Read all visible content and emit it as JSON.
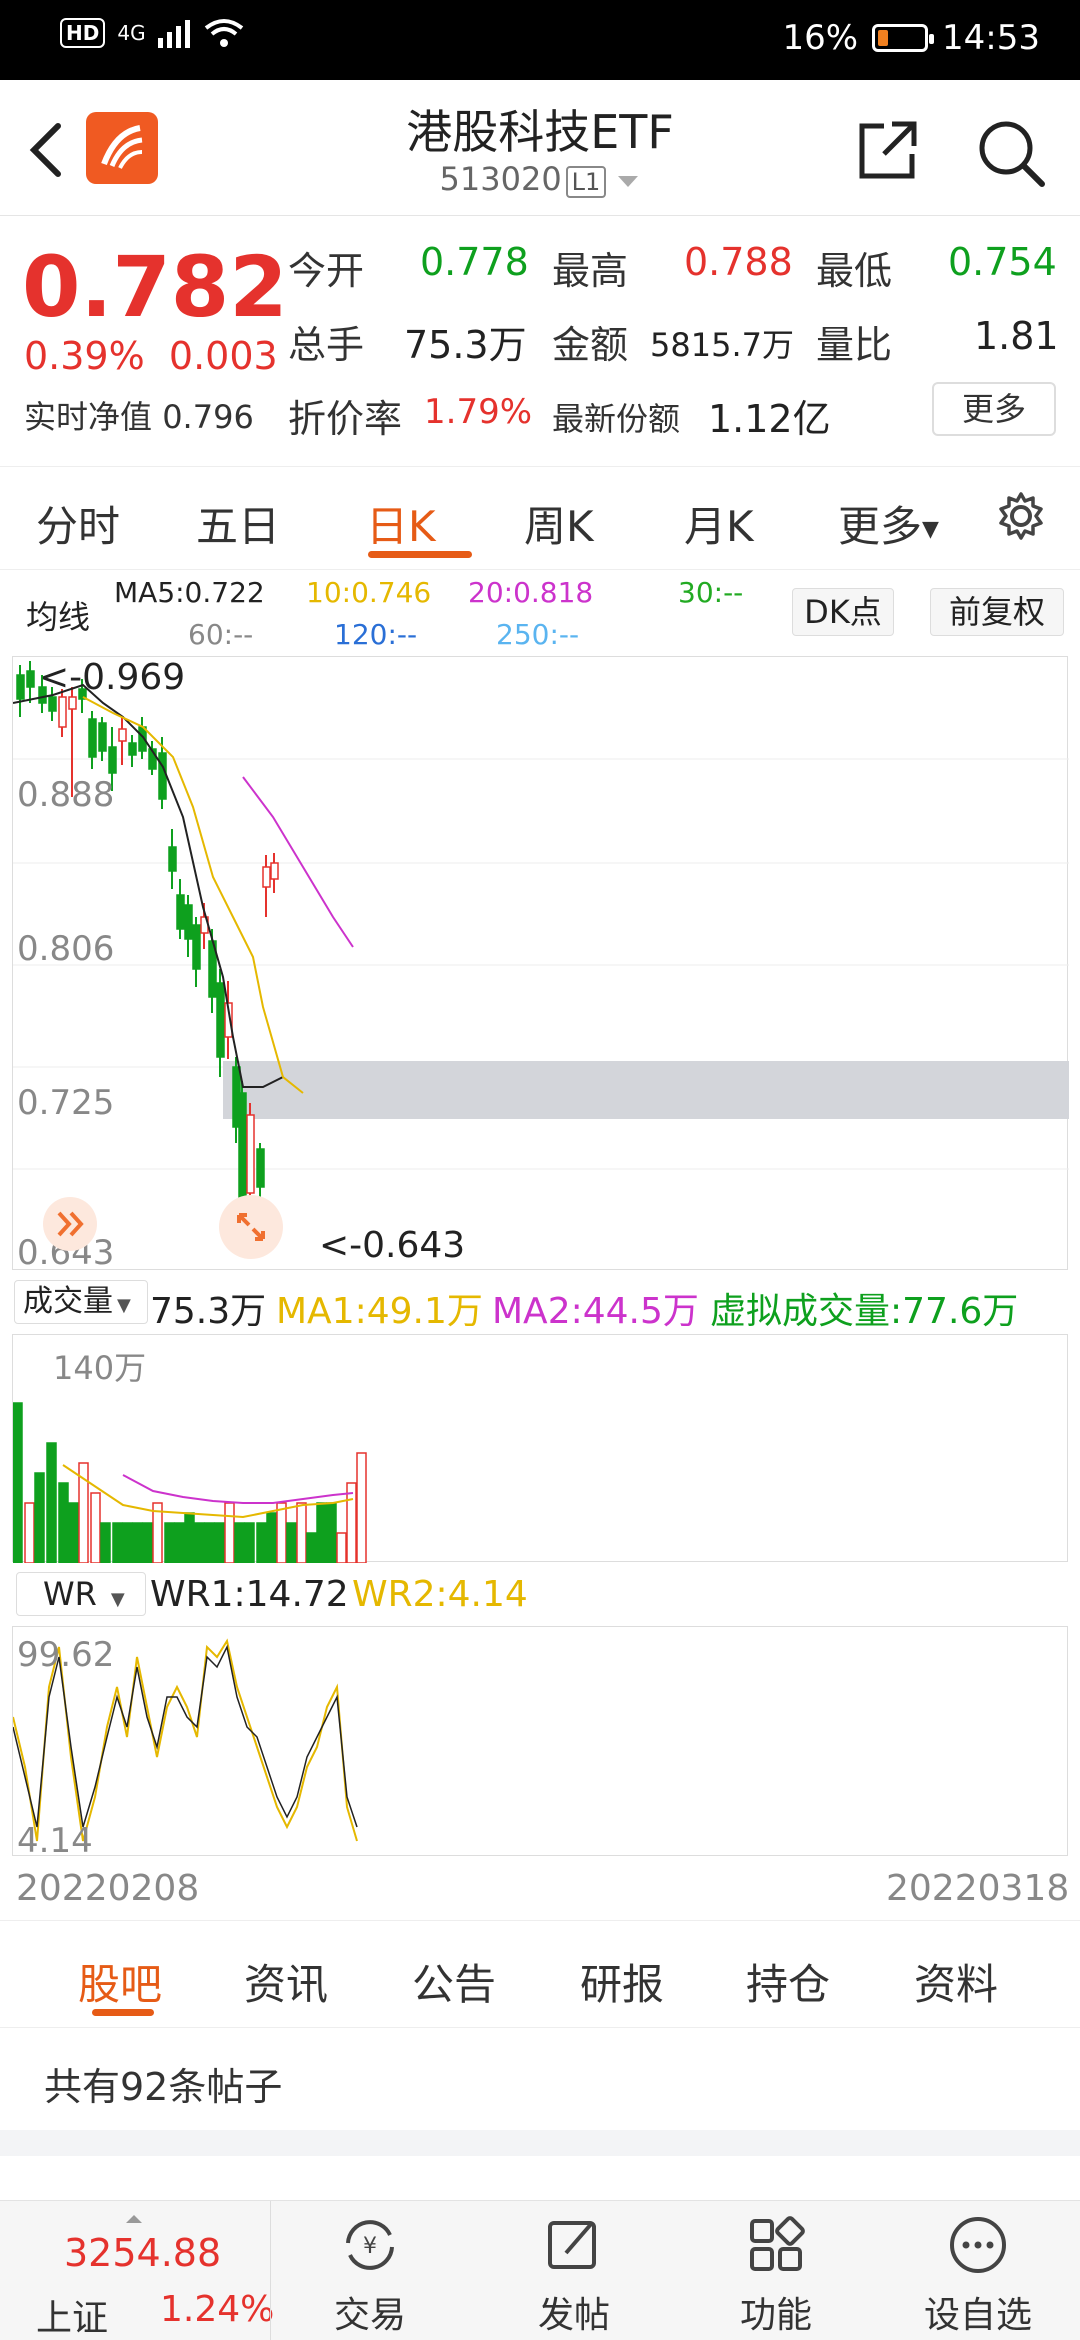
{
  "status": {
    "network": "4G",
    "battery": "16%",
    "time": "14:53"
  },
  "header": {
    "title": "港股科技ETF",
    "code": "513020",
    "level": "L1"
  },
  "quote": {
    "price": "0.782",
    "change_pct": "0.39%",
    "change": "0.003",
    "nav_label": "实时净值",
    "nav_value": "0.796",
    "open_label": "今开",
    "open": "0.778",
    "high_label": "最高",
    "high": "0.788",
    "low_label": "最低",
    "low": "0.754",
    "vol_label": "总手",
    "vol": "75.3万",
    "amount_label": "金额",
    "amount": "5815.7万",
    "ratio_label": "量比",
    "ratio": "1.81",
    "premium_label": "折价率",
    "premium": "1.79%",
    "shares_label": "最新份额",
    "shares": "1.12亿",
    "more": "更多"
  },
  "ktabs": [
    "分时",
    "五日",
    "日K",
    "周K",
    "月K",
    "更多"
  ],
  "ma": {
    "label": "均线",
    "ma5": "MA5:0.722",
    "ma10": "10:0.746",
    "ma20": "20:0.818",
    "ma30": "30:--",
    "ma60": "60:--",
    "ma120": "120:--",
    "ma250": "250:--",
    "dk": "DK点",
    "fq": "前复权",
    "colors": {
      "ma5": "#222222",
      "ma10": "#e5b800",
      "ma20": "#cc33cc",
      "ma30": "#22aa22",
      "ma60": "#888888",
      "ma120": "#2a6fd6",
      "ma250": "#5ab4f0"
    }
  },
  "kchart": {
    "y_labels": [
      "0.888",
      "0.806",
      "0.725",
      "0.643"
    ],
    "max_note": "<-0.969",
    "min_note": "<-0.643"
  },
  "volume": {
    "selector": "成交量",
    "value": "75.3万",
    "ma1": "MA1:49.1万",
    "ma2": "MA2:44.5万",
    "virtual": "虚拟成交量:77.6万",
    "axis": "140万"
  },
  "wr": {
    "selector": "WR",
    "wr1": "WR1:14.72",
    "wr2": "WR2:4.14",
    "top": "99.62",
    "bottom": "4.14"
  },
  "dates": {
    "start": "20220208",
    "end": "20220318"
  },
  "subtabs": [
    "股吧",
    "资讯",
    "公告",
    "研报",
    "持仓",
    "资料"
  ],
  "posts": "共有92条帖子",
  "bottom": {
    "index_value": "3254.88",
    "index_name": "上证",
    "index_pct": "1.24%",
    "items": [
      "交易",
      "发帖",
      "功能",
      "设自选"
    ]
  }
}
